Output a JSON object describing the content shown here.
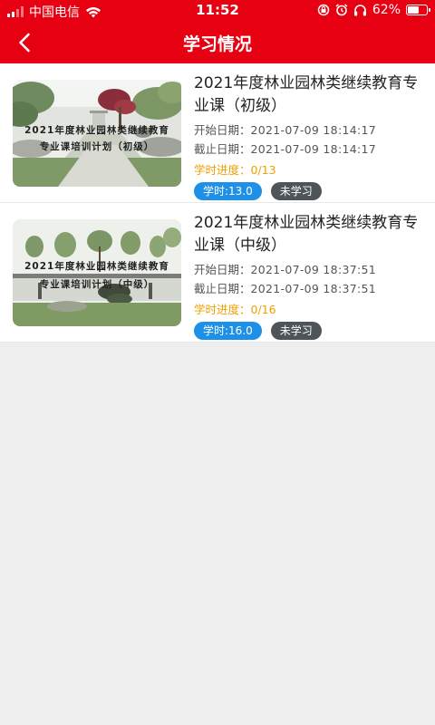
{
  "status_bar": {
    "carrier": "中国电信",
    "time": "11:52",
    "battery_percent": "62%",
    "battery_level": 0.62
  },
  "nav": {
    "back_icon": "chevron-left-icon",
    "title": "学习情况"
  },
  "courses": [
    {
      "title": "2021年度林业园林类继续教育专业课（初级）",
      "thumb_line1": "2021年度林业园林类继续教育",
      "thumb_line2": "专业课培训计划（初级）",
      "start_label": "开始日期：",
      "start_date": "2021-07-09 18:14:17",
      "end_label": "截止日期：",
      "end_date": "2021-07-09 18:14:17",
      "progress_label": "学时进度：",
      "progress_value": "0/13",
      "hours_tag": "学时:13.0",
      "status_tag": "未学习"
    },
    {
      "title": "2021年度林业园林类继续教育专业课（中级）",
      "thumb_line1": "2021年度林业园林类继续教育",
      "thumb_line2": "专业课培训计划（中级）",
      "start_label": "开始日期：",
      "start_date": "2021-07-09 18:37:51",
      "end_label": "截止日期：",
      "end_date": "2021-07-09 18:37:51",
      "progress_label": "学时进度：",
      "progress_value": "0/16",
      "hours_tag": "学时:16.0",
      "status_tag": "未学习"
    }
  ],
  "colors": {
    "header": "#e60012",
    "progress": "#f0a000",
    "hours_tag": "#1e90e8",
    "status_tag": "#4e5559"
  }
}
